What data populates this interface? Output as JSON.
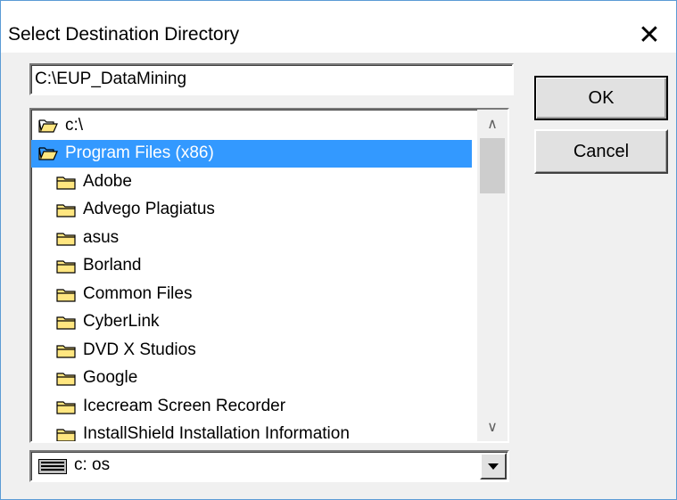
{
  "window": {
    "title": "Select Destination Directory",
    "close_label": "✕"
  },
  "path_input": {
    "value": "C:\\EUP_DataMining"
  },
  "buttons": {
    "ok": "OK",
    "cancel": "Cancel"
  },
  "tree": {
    "items": [
      {
        "label": "c:\\",
        "icon": "open-folder-icon",
        "indent": 0,
        "selected": false
      },
      {
        "label": "Program Files (x86)",
        "icon": "open-folder-icon",
        "indent": 0,
        "selected": true
      },
      {
        "label": "Adobe",
        "icon": "folder-icon",
        "indent": 1,
        "selected": false
      },
      {
        "label": "Advego Plagiatus",
        "icon": "folder-icon",
        "indent": 1,
        "selected": false
      },
      {
        "label": "asus",
        "icon": "folder-icon",
        "indent": 1,
        "selected": false
      },
      {
        "label": "Borland",
        "icon": "folder-icon",
        "indent": 1,
        "selected": false
      },
      {
        "label": "Common Files",
        "icon": "folder-icon",
        "indent": 1,
        "selected": false
      },
      {
        "label": "CyberLink",
        "icon": "folder-icon",
        "indent": 1,
        "selected": false
      },
      {
        "label": "DVD X Studios",
        "icon": "folder-icon",
        "indent": 1,
        "selected": false
      },
      {
        "label": "Google",
        "icon": "folder-icon",
        "indent": 1,
        "selected": false
      },
      {
        "label": "Icecream Screen Recorder",
        "icon": "folder-icon",
        "indent": 1,
        "selected": false
      },
      {
        "label": "InstallShield Installation Information",
        "icon": "folder-icon",
        "indent": 1,
        "selected": false
      }
    ],
    "scroll_up_label": "∧",
    "scroll_down_label": "∨"
  },
  "drive": {
    "label": "c:  os",
    "icon": "drive-icon"
  },
  "colors": {
    "selection": "#3399ff",
    "folder": "#ffe680",
    "dialog_bg": "#f0f0f0"
  }
}
